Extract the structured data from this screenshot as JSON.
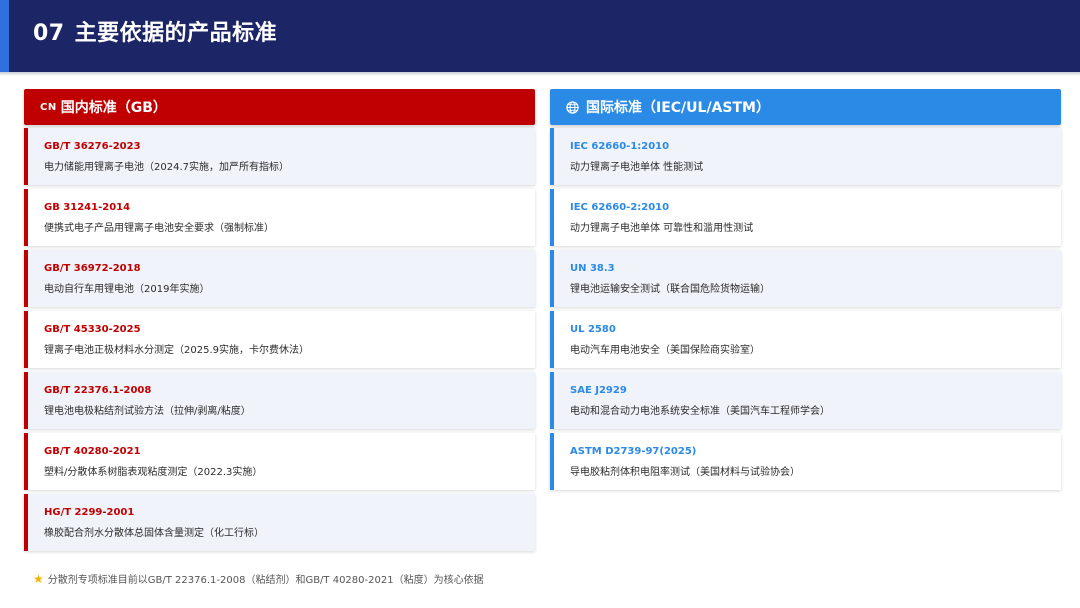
{
  "header": {
    "number": "07",
    "title": "主要依据的产品标准"
  },
  "domestic": {
    "icon_text": "CN",
    "title": "国内标准（GB）",
    "items": [
      {
        "code": "GB/T 36276-2023",
        "desc": "电力储能用锂离子电池（2024.7实施，加严所有指标）"
      },
      {
        "code": "GB 31241-2014",
        "desc": "便携式电子产品用锂离子电池安全要求（强制标准）"
      },
      {
        "code": "GB/T 36972-2018",
        "desc": "电动自行车用锂电池（2019年实施）"
      },
      {
        "code": "GB/T 45330-2025",
        "desc": "锂离子电池正极材料水分测定（2025.9实施，卡尔费休法）"
      },
      {
        "code": "GB/T 22376.1-2008",
        "desc": "锂电池电极粘结剂试验方法（拉伸/剥离/粘度）"
      },
      {
        "code": "GB/T 40280-2021",
        "desc": "塑料/分散体系树脂表观粘度测定（2022.3实施）"
      },
      {
        "code": "HG/T 2299-2001",
        "desc": "橡胶配合剂水分散体总固体含量测定（化工行标）"
      }
    ]
  },
  "international": {
    "icon": "globe-icon",
    "title": "国际标准（IEC/UL/ASTM）",
    "items": [
      {
        "code": "IEC 62660-1:2010",
        "desc": "动力锂离子电池单体 性能测试"
      },
      {
        "code": "IEC 62660-2:2010",
        "desc": "动力锂离子电池单体 可靠性和滥用性测试"
      },
      {
        "code": "UN 38.3",
        "desc": "锂电池运输安全测试（联合国危险货物运输）"
      },
      {
        "code": "UL 2580",
        "desc": "电动汽车用电池安全（美国保险商实验室）"
      },
      {
        "code": "SAE J2929",
        "desc": "电动和混合动力电池系统安全标准（美国汽车工程师学会）"
      },
      {
        "code": "ASTM D2739-97(2025)",
        "desc": "导电胶粘剂体积电阻率测试（美国材料与试验协会）"
      }
    ]
  },
  "footnote": {
    "icon": "star-icon",
    "text": "分散剂专项标准目前以GB/T 22376.1-2008（粘结剂）和GB/T 40280-2021（粘度）为核心依据"
  },
  "colors": {
    "header_bg": "#1c2566",
    "header_accent": "#2f6fe0",
    "domestic_red": "#c00000",
    "international_blue": "#2b8ae6",
    "star": "#f0b400"
  }
}
